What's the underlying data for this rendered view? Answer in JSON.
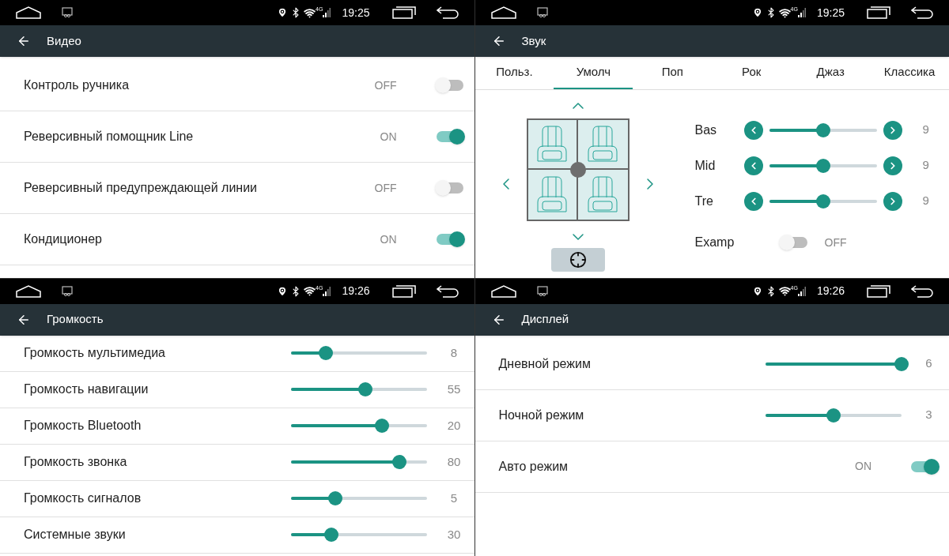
{
  "panels": [
    {
      "kind": "tall_list",
      "status": {
        "time": "19:25",
        "network": "4G"
      },
      "title": "Видео",
      "rows": [
        {
          "kind": "toggle",
          "label": "Контроль ручника",
          "state_text": "OFF",
          "on": false
        },
        {
          "kind": "toggle",
          "label": "Реверсивный помощник Line",
          "state_text": "ON",
          "on": true
        },
        {
          "kind": "toggle",
          "label": "Реверсивный предупреждающей линии",
          "state_text": "OFF",
          "on": false
        },
        {
          "kind": "toggle",
          "label": "Кондиционер",
          "state_text": "ON",
          "on": true
        }
      ]
    },
    {
      "kind": "sound",
      "status": {
        "time": "19:25",
        "network": "4G"
      },
      "title": "Звук",
      "tabs": [
        {
          "label": "Польз.",
          "selected": false
        },
        {
          "label": "Умолч",
          "selected": true
        },
        {
          "label": "Поп",
          "selected": false
        },
        {
          "label": "Рок",
          "selected": false
        },
        {
          "label": "Джаз",
          "selected": false
        },
        {
          "label": "Классика",
          "selected": false
        }
      ],
      "bands": [
        {
          "label": "Bas",
          "level": 0.5,
          "value": "9"
        },
        {
          "label": "Mid",
          "level": 0.5,
          "value": "9"
        },
        {
          "label": "Tre",
          "level": 0.5,
          "value": "9"
        }
      ],
      "examp": {
        "label": "Examp",
        "state_text": "OFF",
        "on": false
      }
    },
    {
      "kind": "compact_list",
      "status": {
        "time": "19:26",
        "network": "4G"
      },
      "title": "Громкость",
      "rows": [
        {
          "kind": "slider",
          "label": "Громкость мультимедиа",
          "level": 0.26,
          "value": "8"
        },
        {
          "kind": "slider",
          "label": "Громкость навигации",
          "level": 0.55,
          "value": "55"
        },
        {
          "kind": "slider",
          "label": "Громкость Bluetooth",
          "level": 0.67,
          "value": "20"
        },
        {
          "kind": "slider",
          "label": "Громкость звонка",
          "level": 0.8,
          "value": "80"
        },
        {
          "kind": "slider",
          "label": "Громкость сигналов",
          "level": 0.33,
          "value": "5"
        },
        {
          "kind": "slider",
          "label": "Системные звуки",
          "level": 0.3,
          "value": "30"
        }
      ]
    },
    {
      "kind": "tall_list",
      "status": {
        "time": "19:26",
        "network": "4G"
      },
      "title": "Дисплей",
      "rows": [
        {
          "kind": "slider",
          "label": "Дневной режим",
          "level": 1,
          "value": "6"
        },
        {
          "kind": "slider",
          "label": "Ночной режим",
          "level": 0.5,
          "value": "3"
        },
        {
          "kind": "toggle",
          "label": "Авто режим",
          "state_text": "ON",
          "on": true
        }
      ]
    }
  ]
}
